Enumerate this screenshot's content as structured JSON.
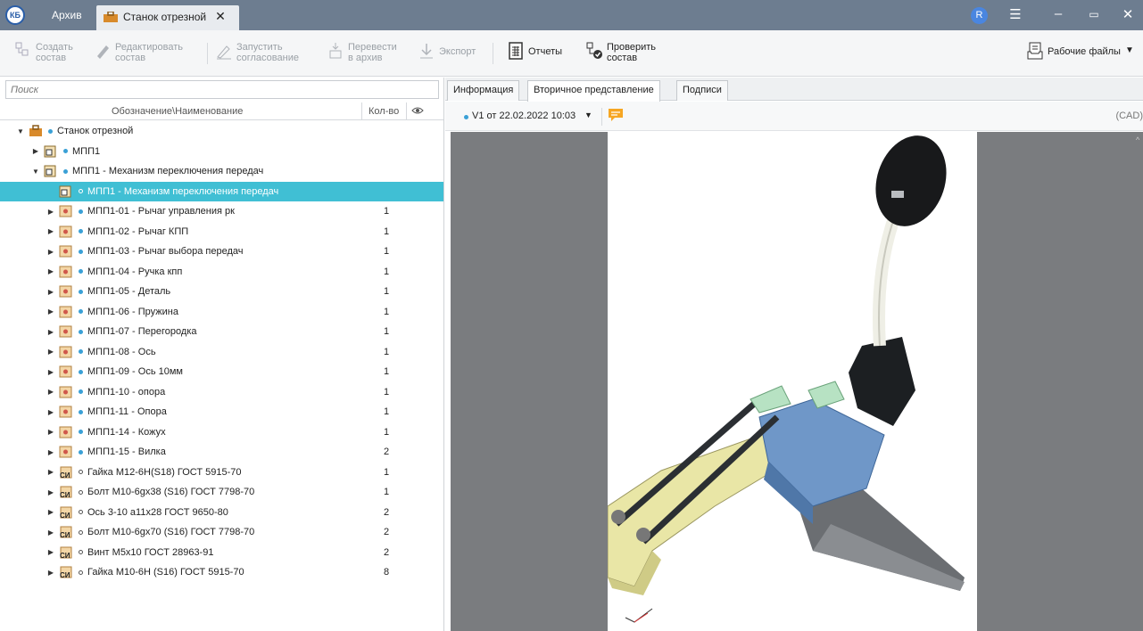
{
  "titlebar": {
    "logo": "КБ",
    "tab_archive": "Архив",
    "tab_active": "Станок отрезной",
    "close_glyph": "✕",
    "user_initial": "R",
    "ctrl_menu": "☰",
    "ctrl_min": "–",
    "ctrl_restore": "▭",
    "ctrl_close": "✕"
  },
  "toolbar": {
    "create": "Создать\nсостав",
    "edit": "Редактировать\nсостав",
    "start_approval": "Запустить\nсогласование",
    "to_archive": "Перевести\nв архив",
    "export": "Экспорт",
    "reports": "Отчеты",
    "check": "Проверить\nсостав",
    "work_files": "Рабочие файлы"
  },
  "search": {
    "placeholder": "Поиск"
  },
  "columns": {
    "name": "Обозначение\\Наименование",
    "qty": "Кол-во"
  },
  "tree": [
    {
      "indent": 0,
      "expand": "▼",
      "icon": "case",
      "dot": "filled",
      "label": "Станок отрезной",
      "qty": "",
      "selected": false
    },
    {
      "indent": 1,
      "expand": "▶",
      "icon": "assembly",
      "dot": "filled",
      "label": "МПП1",
      "qty": "",
      "selected": false
    },
    {
      "indent": 1,
      "expand": "▼",
      "icon": "assembly",
      "dot": "filled",
      "label": "МПП1 - Механизм переключения передач",
      "qty": "",
      "selected": false
    },
    {
      "indent": 2,
      "expand": "",
      "icon": "assembly",
      "dot": "hollow",
      "label": "МПП1 - Механизм переключения передач",
      "qty": "",
      "selected": true
    },
    {
      "indent": 2,
      "expand": "▶",
      "icon": "part",
      "dot": "filled",
      "label": "МПП1-01 - Рычаг управления рк",
      "qty": "1",
      "selected": false
    },
    {
      "indent": 2,
      "expand": "▶",
      "icon": "part",
      "dot": "filled",
      "label": "МПП1-02 - Рычаг КПП",
      "qty": "1",
      "selected": false
    },
    {
      "indent": 2,
      "expand": "▶",
      "icon": "part",
      "dot": "filled",
      "label": "МПП1-03 - Рычаг выбора передач",
      "qty": "1",
      "selected": false
    },
    {
      "indent": 2,
      "expand": "▶",
      "icon": "part",
      "dot": "filled",
      "label": "МПП1-04 - Ручка кпп",
      "qty": "1",
      "selected": false
    },
    {
      "indent": 2,
      "expand": "▶",
      "icon": "part",
      "dot": "filled",
      "label": "МПП1-05 - Деталь",
      "qty": "1",
      "selected": false
    },
    {
      "indent": 2,
      "expand": "▶",
      "icon": "part",
      "dot": "filled",
      "label": "МПП1-06 - Пружина",
      "qty": "1",
      "selected": false
    },
    {
      "indent": 2,
      "expand": "▶",
      "icon": "part",
      "dot": "filled",
      "label": "МПП1-07 - Перегородка",
      "qty": "1",
      "selected": false
    },
    {
      "indent": 2,
      "expand": "▶",
      "icon": "part",
      "dot": "filled",
      "label": "МПП1-08 - Ось",
      "qty": "1",
      "selected": false
    },
    {
      "indent": 2,
      "expand": "▶",
      "icon": "part",
      "dot": "filled",
      "label": "МПП1-09 - Ось 10мм",
      "qty": "1",
      "selected": false
    },
    {
      "indent": 2,
      "expand": "▶",
      "icon": "part",
      "dot": "filled",
      "label": "МПП1-10 - опора",
      "qty": "1",
      "selected": false
    },
    {
      "indent": 2,
      "expand": "▶",
      "icon": "part",
      "dot": "filled",
      "label": "МПП1-11 - Опора",
      "qty": "1",
      "selected": false
    },
    {
      "indent": 2,
      "expand": "▶",
      "icon": "part",
      "dot": "filled",
      "label": "МПП1-14 - Кожух",
      "qty": "1",
      "selected": false
    },
    {
      "indent": 2,
      "expand": "▶",
      "icon": "part",
      "dot": "filled",
      "label": "МПП1-15 - Вилка",
      "qty": "2",
      "selected": false
    },
    {
      "indent": 2,
      "expand": "▶",
      "icon": "standard",
      "dot": "hollow",
      "label": "Гайка М12-6Н(S18) ГОСТ 5915-70",
      "qty": "1",
      "selected": false
    },
    {
      "indent": 2,
      "expand": "▶",
      "icon": "standard",
      "dot": "hollow",
      "label": "Болт М10-6gx38 (S16) ГОСТ 7798-70",
      "qty": "1",
      "selected": false
    },
    {
      "indent": 2,
      "expand": "▶",
      "icon": "standard",
      "dot": "hollow",
      "label": "Ось 3-10 а11х28 ГОСТ 9650-80",
      "qty": "2",
      "selected": false
    },
    {
      "indent": 2,
      "expand": "▶",
      "icon": "standard",
      "dot": "hollow",
      "label": "Болт М10-6gx70 (S16) ГОСТ 7798-70",
      "qty": "2",
      "selected": false
    },
    {
      "indent": 2,
      "expand": "▶",
      "icon": "standard",
      "dot": "hollow",
      "label": "Винт М5х10 ГОСТ 28963-91",
      "qty": "2",
      "selected": false
    },
    {
      "indent": 2,
      "expand": "▶",
      "icon": "standard",
      "dot": "hollow",
      "label": "Гайка М10-6Н (S16) ГОСТ 5915-70",
      "qty": "8",
      "selected": false
    }
  ],
  "right_tabs": {
    "info": "Информация",
    "secondary": "Вторичное представление",
    "signatures": "Подписи"
  },
  "version": {
    "label": "V1 от 22.02.2022 10:03",
    "caret": "▼",
    "cad": "(CAD)"
  },
  "colors": {
    "accent": "#40bfd4",
    "titlebar": "#6d7d90",
    "dot": "#3aa0d6",
    "comment": "#f6a623"
  }
}
